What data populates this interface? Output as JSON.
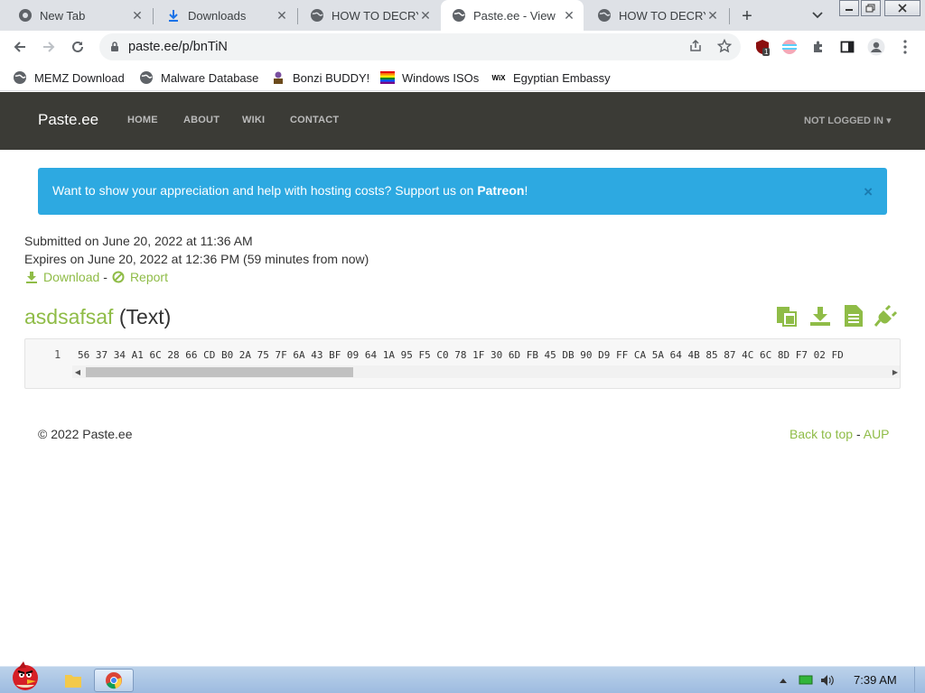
{
  "browser": {
    "tabs": [
      {
        "title": "New Tab",
        "icon": "chrome-icon"
      },
      {
        "title": "Downloads",
        "icon": "download-icon"
      },
      {
        "title": "HOW TO DECRY",
        "icon": "globe-icon"
      },
      {
        "title": "Paste.ee - View",
        "icon": "globe-icon",
        "active": true
      },
      {
        "title": "HOW TO DECRY",
        "icon": "globe-icon"
      }
    ],
    "url": "paste.ee/p/bnTiN",
    "extension_badge": "1"
  },
  "bookmarks": [
    {
      "label": "MEMZ Download",
      "icon": "globe-icon"
    },
    {
      "label": "Malware Database",
      "icon": "globe-icon"
    },
    {
      "label": "Bonzi BUDDY!",
      "icon": "bonzi-icon"
    },
    {
      "label": "Windows ISOs",
      "icon": "rainbow-flag-icon"
    },
    {
      "label": "Egyptian Embassy",
      "icon": "wix-icon"
    }
  ],
  "site": {
    "brand": "Paste.ee",
    "nav": [
      "HOME",
      "ABOUT",
      "WIKI",
      "CONTACT"
    ],
    "login": "NOT LOGGED IN",
    "accent": "#8fbc47",
    "navbar_color": "#3b3b36"
  },
  "alert": {
    "text": "Want to show your appreciation and help with hosting costs? Support us on ",
    "link": "Patreon",
    "suffix": "!",
    "close": "×",
    "color": "#2da9e1"
  },
  "paste": {
    "submitted": "Submitted on June 20, 2022 at 11:36 AM",
    "expires": "Expires on June 20, 2022 at 12:36 PM (59 minutes from now)",
    "download_label": "Download",
    "separator": "-",
    "report_label": "Report",
    "name": "asdsafsaf",
    "type": "(Text)",
    "line_number": "1",
    "content": "56 37 34 A1 6C 28 66 CD B0 2A 75 7F 6A 43 BF 09 64 1A 95 F5 C0 78 1F 30 6D FB 45 DB 90 D9 FF CA 5A 64 4B 85 87 4C 6C 8D F7 02 FD"
  },
  "footer": {
    "copyright": "© 2022 Paste.ee",
    "back_to_top": "Back to top",
    "separator": "-",
    "aup": "AUP"
  },
  "taskbar": {
    "time": "7:39 AM"
  }
}
